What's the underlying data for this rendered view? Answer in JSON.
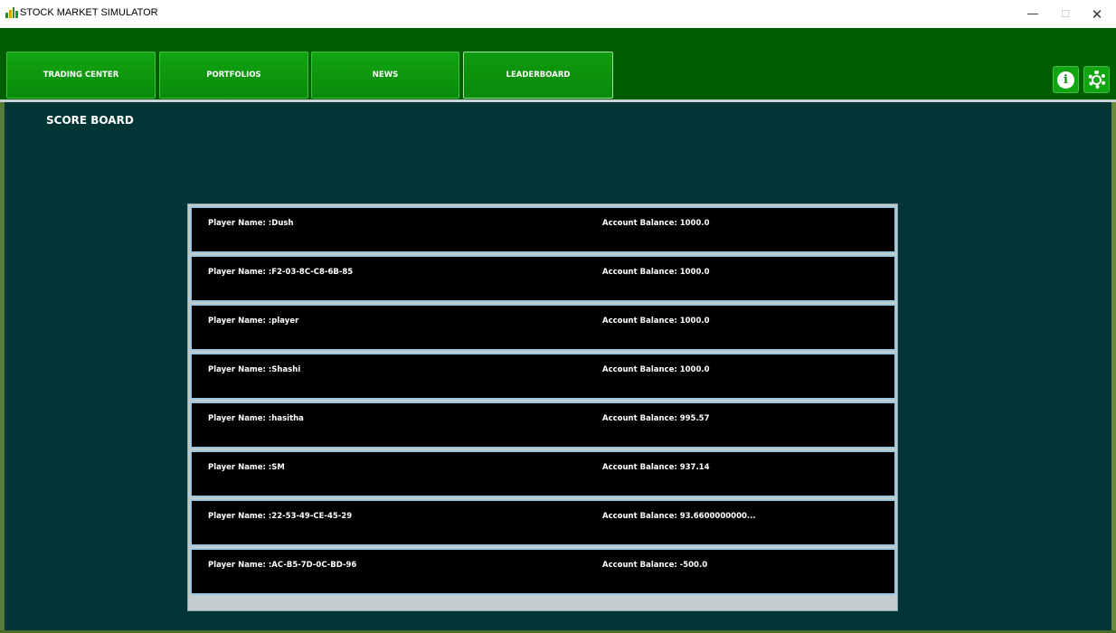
{
  "window": {
    "title": "STOCK MARKET SIMULATOR",
    "icon": "bar-chart-icon",
    "controls": {
      "minimize": "—",
      "maximize": "☐",
      "close": "✕"
    }
  },
  "tabs": [
    {
      "label": "TRADING CENTER",
      "selected": false
    },
    {
      "label": "PORTFOLIOS",
      "selected": false
    },
    {
      "label": "NEWS",
      "selected": false
    },
    {
      "label": "LEADERBOARD",
      "selected": true
    }
  ],
  "header_buttons": {
    "info_icon": "info-icon",
    "info_glyph": "i",
    "settings_icon": "gear-icon"
  },
  "page": {
    "title": "SCORE BOARD"
  },
  "leaderboard": [
    {
      "name": "Player Name: :Dush",
      "balance": "Account Balance: 1000.0"
    },
    {
      "name": "Player Name: :F2-03-8C-C8-6B-85",
      "balance": "Account Balance: 1000.0"
    },
    {
      "name": "Player Name: :player",
      "balance": "Account Balance: 1000.0"
    },
    {
      "name": "Player Name: :Shashi",
      "balance": "Account Balance: 1000.0"
    },
    {
      "name": "Player Name: :hasitha",
      "balance": "Account Balance: 995.57"
    },
    {
      "name": "Player Name: :SM",
      "balance": "Account Balance: 937.14"
    },
    {
      "name": "Player Name: :22-53-49-CE-45-29",
      "balance": "Account Balance: 93.6600000000..."
    },
    {
      "name": "Player Name: :AC-B5-7D-0C-BD-96",
      "balance": "Account Balance: -500.0"
    }
  ],
  "colors": {
    "header_green": "#005e00",
    "tab_green": "#12a512",
    "content_bg": "#023535",
    "row_bg": "#000000",
    "row_border": "#9cc6e0"
  }
}
